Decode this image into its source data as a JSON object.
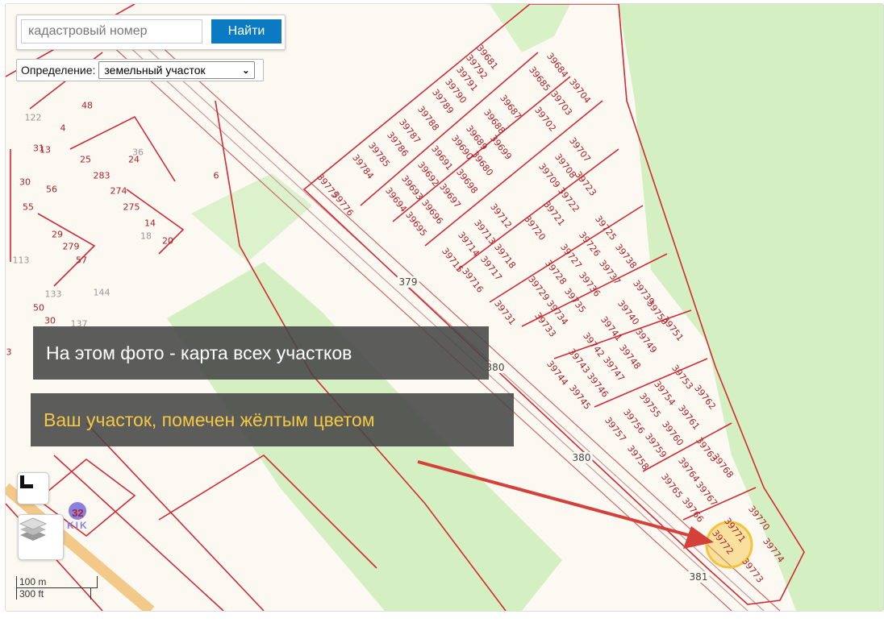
{
  "search": {
    "placeholder": "кадастровый номер",
    "button_label": "Найти"
  },
  "definition": {
    "label": "Определение:",
    "selected": "земельный участок"
  },
  "overlay": {
    "caption_1": "На этом фото - карта всех участков",
    "caption_2": "Ваш участок, помечен жёлтым цветом",
    "caption_1_color": "#ffffff",
    "caption_2_color": "#f5c842"
  },
  "highlighted_parcel": "39772",
  "parcels": [
    "39681",
    "39792",
    "39791",
    "39790",
    "39789",
    "39788",
    "39787",
    "39786",
    "39785",
    "39784",
    "39775",
    "39776",
    "39684",
    "39685",
    "39704",
    "39703",
    "39687",
    "39688",
    "39702",
    "39689",
    "39690",
    "39699",
    "39680",
    "39691",
    "39692",
    "39698",
    "39693",
    "39697",
    "39694",
    "39696",
    "39695",
    "39707",
    "39708",
    "39709",
    "39723",
    "39722",
    "39721",
    "39720",
    "39712",
    "39713",
    "39714",
    "39715",
    "39716",
    "39717",
    "39718",
    "39725",
    "39726",
    "39727",
    "39738",
    "39737",
    "39728",
    "39736",
    "39729",
    "39735",
    "39734",
    "39733",
    "39731",
    "39739",
    "39750",
    "39740",
    "39751",
    "39741",
    "39749",
    "39742",
    "39748",
    "39743",
    "39747",
    "39744",
    "39746",
    "39745",
    "39753",
    "39762",
    "39754",
    "39755",
    "39761",
    "39756",
    "39760",
    "39757",
    "39759",
    "39758",
    "39763",
    "39768",
    "39764",
    "39765",
    "39767",
    "39766",
    "39770",
    "39771",
    "39774",
    "39772",
    "39773"
  ],
  "other_labels": [
    "122",
    "48",
    "4",
    "13",
    "31",
    "25",
    "24",
    "36",
    "30",
    "283",
    "274",
    "56",
    "55",
    "275",
    "14",
    "18",
    "20",
    "29",
    "279",
    "57",
    "113",
    "144",
    "133",
    "50",
    "30",
    "137",
    "3",
    "6"
  ],
  "area_labels": [
    "379",
    "380",
    "380",
    "381"
  ],
  "poi": {
    "number": "32",
    "name": "KIK"
  },
  "scale": {
    "metric": "100 m",
    "imperial": "300 ft"
  },
  "colors": {
    "parcel_border": "#d42a35",
    "forest": "#d4efc2",
    "background": "#fbf9f1",
    "highlight": "#f5c23a",
    "search_button": "#0a7ac3"
  }
}
